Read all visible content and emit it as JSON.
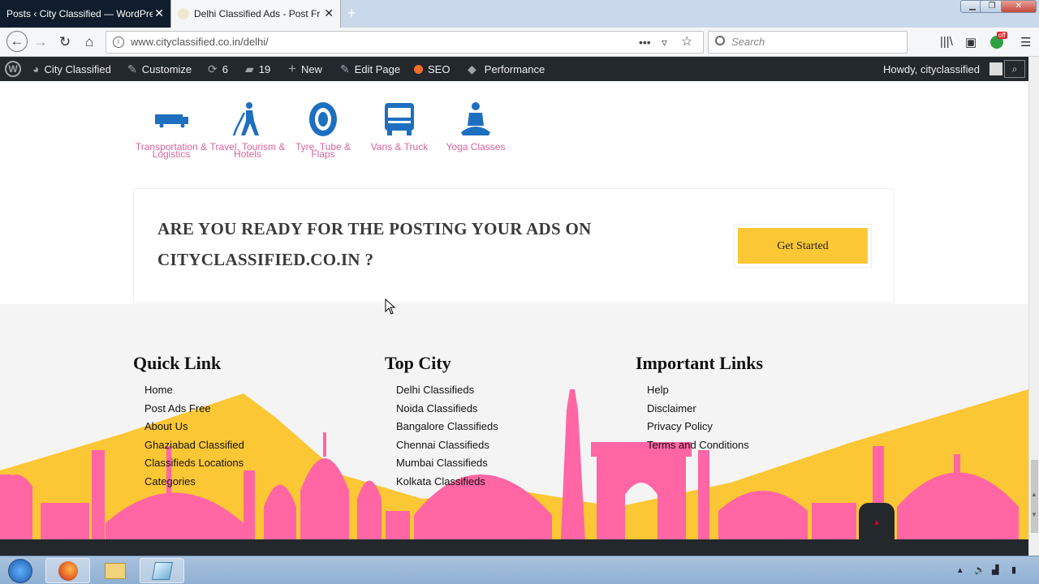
{
  "browser": {
    "tabs": [
      {
        "title": "Posts ‹ City Classified — WordPress"
      },
      {
        "title": "Delhi Classified Ads - Post Free"
      }
    ],
    "url": "www.cityclassified.co.in/delhi/",
    "search_placeholder": "Search",
    "addon_badge": "off"
  },
  "wp_admin_bar": {
    "site_name": "City Classified",
    "customize": "Customize",
    "updates": "6",
    "comments": "19",
    "new": "New",
    "edit_page": "Edit Page",
    "seo": "SEO",
    "performance": "Performance",
    "howdy": "Howdy, cityclassified"
  },
  "categories": [
    {
      "label": "Transportation & Logistics",
      "icon": "truck-icon"
    },
    {
      "label": "Travel, Tourism & Hotels",
      "icon": "walking-traveler-icon"
    },
    {
      "label": "Tyre, Tube & Flaps",
      "icon": "tyre-icon"
    },
    {
      "label": "Vans & Truck",
      "icon": "bus-icon"
    },
    {
      "label": "Yoga Classes",
      "icon": "yoga-icon"
    }
  ],
  "cta": {
    "heading": "ARE YOU READY FOR THE POSTING YOUR ADS ON CITYCLASSIFIED.CO.IN ?",
    "button": "Get Started"
  },
  "footer": {
    "quick_link": {
      "title": "Quick Link",
      "items": [
        "Home",
        "Post Ads Free",
        "About Us",
        "Ghaziabad Classified",
        "Classifieds Locations",
        "Categories"
      ]
    },
    "top_city": {
      "title": "Top City",
      "items": [
        "Delhi Classifieds",
        "Noida Classifieds",
        "Bangalore Classifieds",
        "Chennai Classifieds",
        "Mumbai Classifieds",
        "Kolkata Classifieds"
      ]
    },
    "important_links": {
      "title": "Important Links",
      "items": [
        "Help",
        "Disclaimer",
        "Privacy Policy",
        "Terms and Conditions"
      ]
    }
  },
  "colors": {
    "accent_yellow": "#fcc735",
    "skyline_pink": "#ff66a3",
    "category_pink": "#d9649a",
    "icon_blue": "#1e6fc0",
    "wp_bar": "#23282d"
  }
}
